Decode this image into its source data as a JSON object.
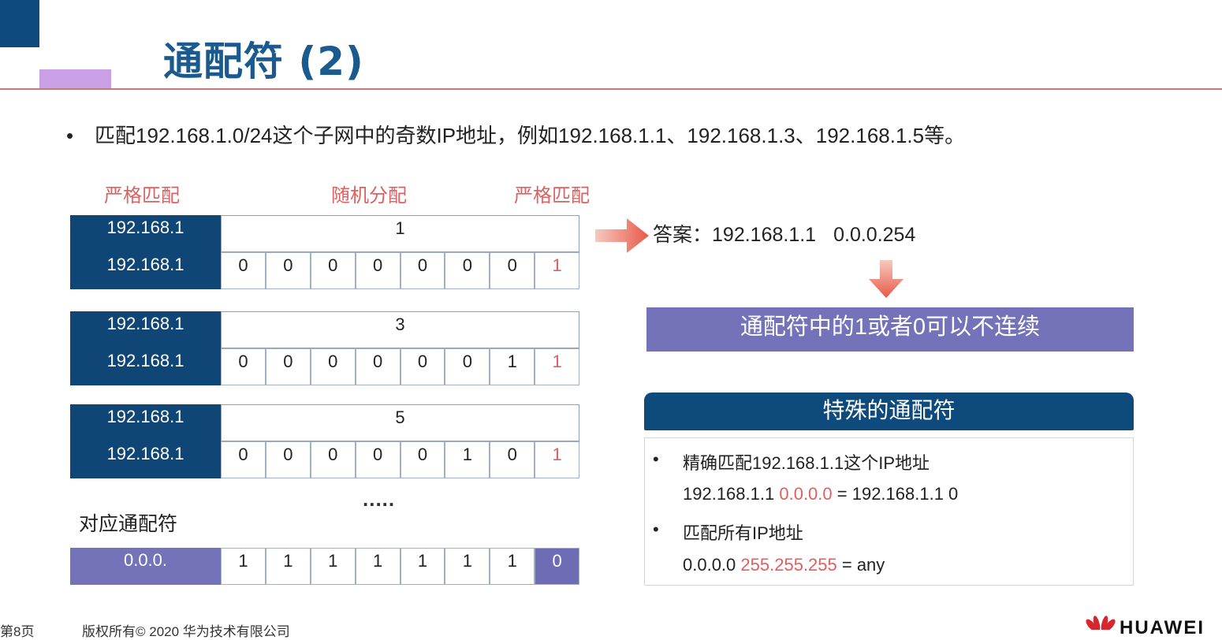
{
  "slide": {
    "title": "通配符 (2)",
    "bullet": "匹配192.168.1.0/24这个子网中的奇数IP地址，例如192.168.1.1、192.168.1.3、192.168.1.5等。",
    "bullet_symbol": "•"
  },
  "labels": {
    "strict_left": "严格匹配",
    "random": "随机分配",
    "strict_right": "严格匹配",
    "ellipsis": ".....",
    "wildcard": "对应通配符"
  },
  "examples": [
    {
      "prefix": "192.168.1",
      "value": "1",
      "bin_prefix": "192.168.1",
      "bits": [
        "0",
        "0",
        "0",
        "0",
        "0",
        "0",
        "0",
        "1"
      ]
    },
    {
      "prefix": "192.168.1",
      "value": "3",
      "bin_prefix": "192.168.1",
      "bits": [
        "0",
        "0",
        "0",
        "0",
        "0",
        "0",
        "1",
        "1"
      ]
    },
    {
      "prefix": "192.168.1",
      "value": "5",
      "bin_prefix": "192.168.1",
      "bits": [
        "0",
        "0",
        "0",
        "0",
        "0",
        "1",
        "0",
        "1"
      ]
    }
  ],
  "wildcard_row": {
    "prefix": "0.0.0.",
    "bits": [
      "1",
      "1",
      "1",
      "1",
      "1",
      "1",
      "1",
      "0"
    ]
  },
  "answer": {
    "label": "答案：",
    "address": "192.168.1.1",
    "wildcard": "0.0.0.254"
  },
  "noncontiguous_note": "通配符中的1或者0可以不连续",
  "special": {
    "header": "特殊的通配符",
    "item1_text": "精确匹配192.168.1.1这个IP地址",
    "item1_addr": "192.168.1.1",
    "item1_wild": "0.0.0.0",
    "item1_eq": " = 192.168.1.1 0",
    "item2_text": "匹配所有IP地址",
    "item2_addr": "0.0.0.0",
    "item2_wild": "255.255.255",
    "item2_eq": " = any"
  },
  "footer": {
    "page": "第8页",
    "copyright": "版权所有© 2020 华为技术有限公司",
    "brand": "HUAWEI"
  },
  "colors": {
    "navy": "#0f4675",
    "purple": "#7472b8",
    "red": "#e06060",
    "title_blue": "#1a5a8f"
  }
}
